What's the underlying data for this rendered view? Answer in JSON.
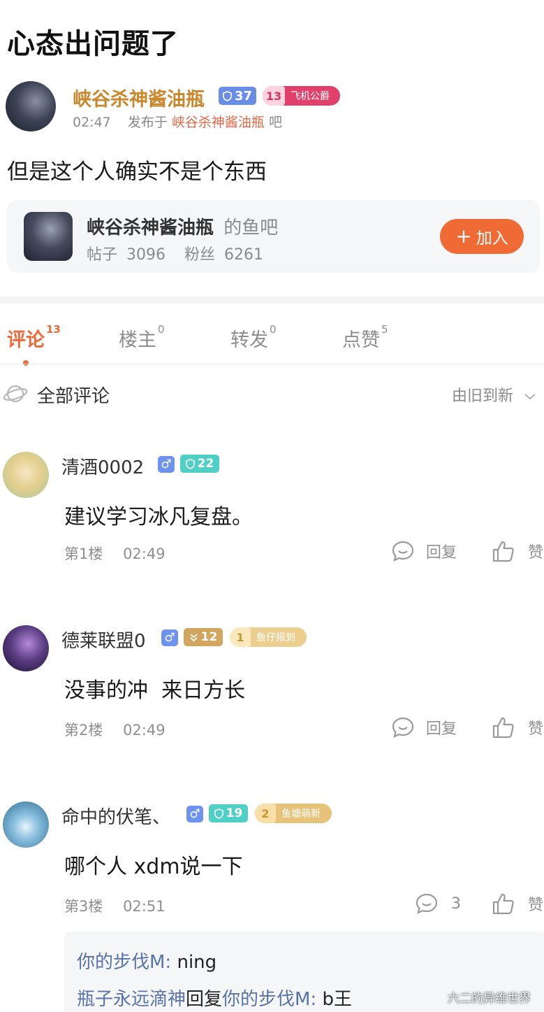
{
  "post": {
    "title": "心态出问题了",
    "author": "峡谷杀神酱油瓶",
    "author_level": "37",
    "author_title_level": "13",
    "author_title": "飞机公爵",
    "time": "02:47",
    "posted_in_label": "发布于",
    "posted_in": "峡谷杀神酱油瓶",
    "posted_in_suffix": "吧",
    "content": "但是这个人确实不是个东西"
  },
  "community_card": {
    "name": "峡谷杀神酱油瓶",
    "suffix": "的鱼吧",
    "posts_label": "帖子",
    "posts": "3096",
    "fans_label": "粉丝",
    "fans": "6261",
    "join_label": "加入"
  },
  "tabs": [
    {
      "label": "评论",
      "count": "13",
      "active": true
    },
    {
      "label": "楼主",
      "count": "0"
    },
    {
      "label": "转发",
      "count": "0"
    },
    {
      "label": "点赞",
      "count": "5"
    }
  ],
  "comments_header": {
    "label": "全部评论",
    "sort": "由旧到新"
  },
  "comments": [
    {
      "name": "清酒0002",
      "gender": "♂",
      "level": "22",
      "text": "建议学习冰凡复盘。",
      "floor": "第1楼",
      "time": "02:49",
      "reply_label": "回复",
      "like_label": "赞"
    },
    {
      "name": "德莱联盟0",
      "gender": "♂",
      "level": "12",
      "title_level": "1",
      "title": "鱼仔报到",
      "text": "没事的冲  来日方长",
      "floor": "第2楼",
      "time": "02:49",
      "reply_label": "回复",
      "like_label": "赞"
    },
    {
      "name": "命中的伏笔、",
      "gender": "♂",
      "level": "19",
      "title_level": "2",
      "title": "鱼塘萌新",
      "text": "哪个人 xdm说一下",
      "floor": "第3楼",
      "time": "02:51",
      "reply_count": "3",
      "like_label": "赞"
    }
  ],
  "replies": [
    {
      "user": "你的步伐M:",
      "text": "ning"
    },
    {
      "user": "瓶子永远滴神",
      "reply_word": "回复",
      "target": "你的步伐M:",
      "text": "b王"
    }
  ],
  "watermark": "六二的异维世界",
  "colors": {
    "accent_orange": "#ed6a3b",
    "author_gold": "#c9872e",
    "level_blue": "#6a8de6",
    "level_teal": "#4fcfc6",
    "title_pink": "#e0406a",
    "title_gold": "#e7c37a",
    "reply_user_blue": "#5873a8"
  }
}
